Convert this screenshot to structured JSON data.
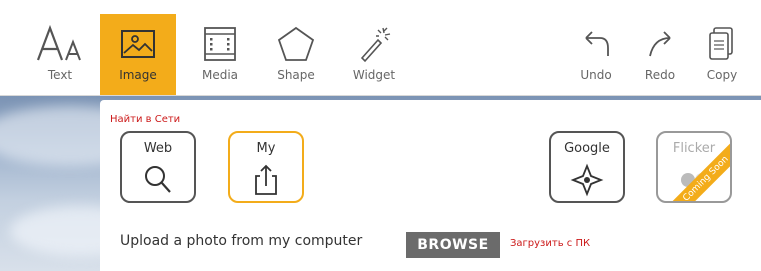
{
  "toolbar": {
    "tools": [
      {
        "label": "Text",
        "icon": "text-icon"
      },
      {
        "label": "Image",
        "icon": "image-icon",
        "active": true
      },
      {
        "label": "Media",
        "icon": "film-icon"
      },
      {
        "label": "Shape",
        "icon": "pentagon-icon"
      },
      {
        "label": "Widget",
        "icon": "magic-wand-icon"
      },
      {
        "label": "Undo",
        "icon": "undo-icon"
      },
      {
        "label": "Redo",
        "icon": "redo-icon"
      },
      {
        "label": "Copy",
        "icon": "copy-icon"
      }
    ]
  },
  "panel": {
    "search_hint": "Найти в Сети",
    "sources": [
      {
        "label": "Web",
        "icon": "search-icon"
      },
      {
        "label": "My",
        "icon": "upload-icon"
      },
      {
        "label": "Google",
        "icon": "google-compass-icon"
      },
      {
        "label": "Flicker",
        "icon": "flickr-icon",
        "badge": "Coming Soon"
      }
    ],
    "upload_text": "Upload a photo from my computer",
    "browse_label": "BROWSE",
    "browse_hint": "Загрузить с ПК"
  },
  "colors": {
    "accent": "#f3ac1a",
    "hint_red": "#cc1a1a",
    "browse_bg": "#6b6b6b"
  }
}
